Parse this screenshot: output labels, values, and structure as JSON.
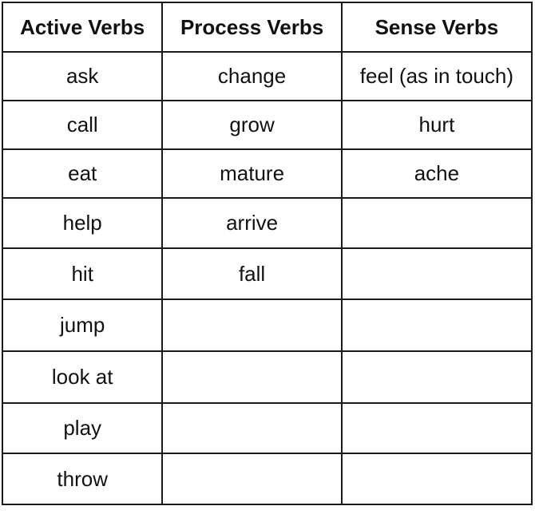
{
  "table": {
    "headers": [
      "Active Verbs",
      "Process Verbs",
      "Sense Verbs"
    ],
    "rows": [
      [
        "ask",
        "change",
        "feel (as in touch)"
      ],
      [
        "call",
        "grow",
        "hurt"
      ],
      [
        "eat",
        "mature",
        "ache"
      ],
      [
        "help",
        "arrive",
        ""
      ],
      [
        "hit",
        "fall",
        ""
      ],
      [
        "jump",
        "",
        ""
      ],
      [
        "look at",
        "",
        ""
      ],
      [
        "play",
        "",
        ""
      ],
      [
        "throw",
        "",
        ""
      ]
    ]
  }
}
